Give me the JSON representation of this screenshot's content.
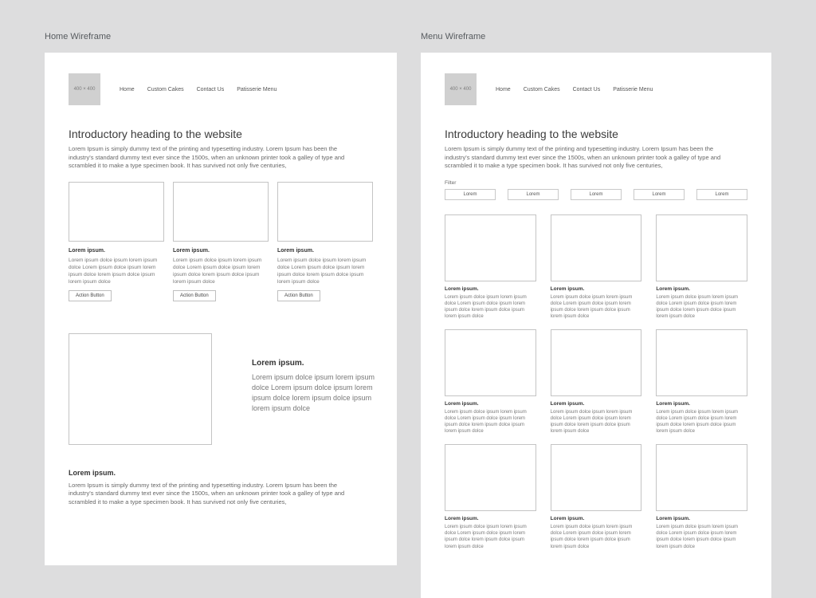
{
  "panels": {
    "home": "Home Wireframe",
    "menu": "Menu Wireframe"
  },
  "logo_text": "400 × 400",
  "nav": [
    "Home",
    "Custom Cakes",
    "Contact Us",
    "Patisserie Menu"
  ],
  "intro": {
    "heading": "Introductory heading to the website",
    "body": "Lorem Ipsum is simply dummy text of the printing and typesetting industry. Lorem Ipsum has been the industry's standard dummy text ever since the 1500s, when an unknown printer took a galley of type and scrambled it to make a type specimen book. It has survived not only five centuries,"
  },
  "card": {
    "heading": "Lorem ipsum.",
    "body": "Lorem ipsum dolce ipsum lorem ipsum dolce Lorem ipsum dolce ipsum lorem ipsum dolce lorem ipsum dolce ipsum lorem ipsum dolce",
    "button": "Action Button"
  },
  "feature": {
    "heading": "Lorem ipsum.",
    "body": "Lorem ipsum dolce ipsum lorem ipsum dolce Lorem ipsum dolce ipsum lorem ipsum dolce lorem ipsum dolce ipsum lorem ipsum dolce"
  },
  "section2": {
    "heading": "Lorem ipsum.",
    "body": "Lorem Ipsum is simply dummy text of the printing and typesetting industry. Lorem Ipsum has been the industry's standard dummy text ever since the 1500s, when an unknown printer took a galley of type and scrambled it to make a type specimen book. It has survived not only five centuries,"
  },
  "filter": {
    "label": "Filter",
    "button": "Lorem"
  },
  "menu_item": {
    "heading": "Lorem ipsum.",
    "body": "Lorem ipsum dolce ipsum lorem ipsum dolce Lorem ipsum dolce ipsum lorem ipsum dolce lorem ipsum dolce ipsum lorem ipsum dolce"
  }
}
